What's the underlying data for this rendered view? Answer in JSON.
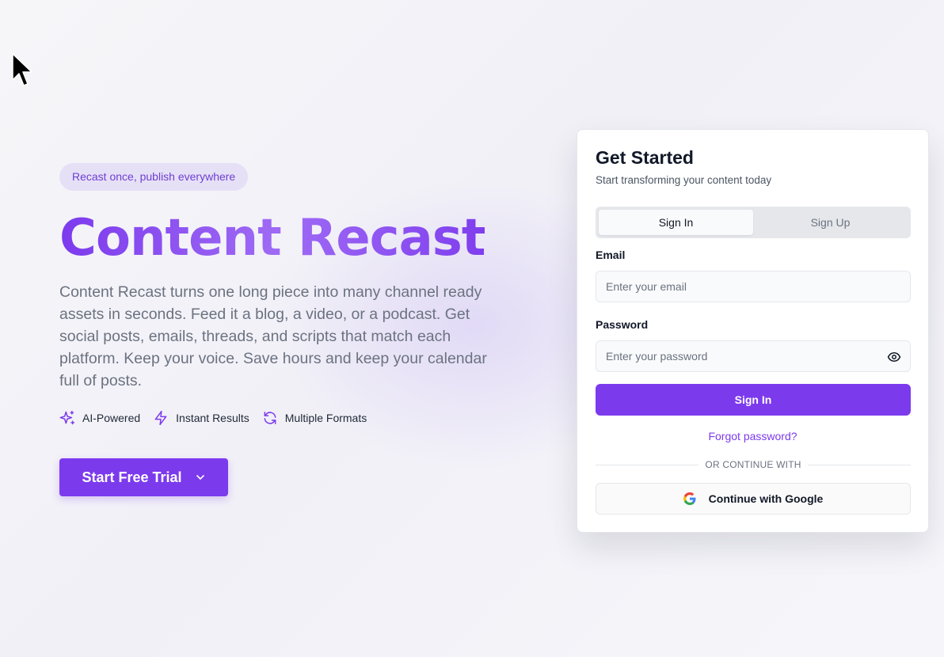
{
  "hero": {
    "badge": "Recast once, publish everywhere",
    "title": "Content Recast",
    "description": "Content Recast turns one long piece into many channel ready assets in seconds. Feed it a blog, a video, or a podcast. Get social posts, emails, threads, and scripts that match each platform. Keep your voice. Save hours and keep your calendar full of posts.",
    "features": [
      {
        "icon": "sparkles-icon",
        "label": "AI-Powered"
      },
      {
        "icon": "lightning-icon",
        "label": "Instant Results"
      },
      {
        "icon": "refresh-icon",
        "label": "Multiple Formats"
      }
    ],
    "cta_label": "Start Free Trial",
    "cta_icon": "chevron-down-icon"
  },
  "auth": {
    "title": "Get Started",
    "subtitle": "Start transforming your content today",
    "tabs": [
      {
        "label": "Sign In",
        "active": true
      },
      {
        "label": "Sign Up",
        "active": false
      }
    ],
    "email_label": "Email",
    "email_placeholder": "Enter your email",
    "email_value": "",
    "password_label": "Password",
    "password_placeholder": "Enter your password",
    "password_value": "",
    "password_toggle_icon": "eye-icon",
    "submit_label": "Sign In",
    "forgot_label": "Forgot password?",
    "divider_label": "OR CONTINUE WITH",
    "google_label": "Continue with Google",
    "google_icon": "google-icon"
  },
  "colors": {
    "accent": "#7c3aed",
    "badge_bg": "#e6e0f7",
    "badge_text": "#6d3fd0"
  }
}
